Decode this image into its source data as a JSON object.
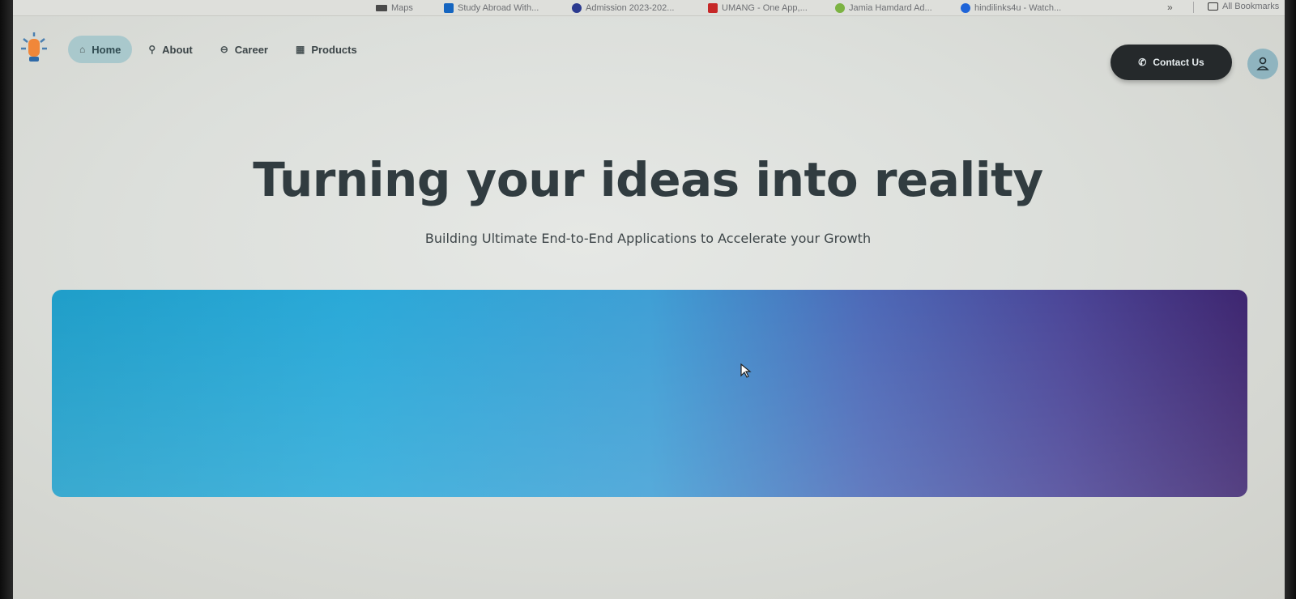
{
  "bookmarks": [
    {
      "label": "Study Abroad With...",
      "color": "#1565c0"
    },
    {
      "label": "Admission 2023-202...",
      "color": "#2b3a8f"
    },
    {
      "label": "UMANG - One App,...",
      "color": "#c62828"
    },
    {
      "label": "Jamia Hamdard Ad...",
      "color": "#7cb342"
    },
    {
      "label": "hindilinks4u - Watch...",
      "color": "#1e64d8"
    }
  ],
  "bookmarks_extra": {
    "maps_label": "Maps",
    "chevron": "»",
    "all_bookmarks": "All Bookmarks"
  },
  "nav": {
    "items": [
      {
        "label": "Home",
        "icon": "home-icon",
        "active": true
      },
      {
        "label": "About",
        "icon": "pin-icon",
        "active": false
      },
      {
        "label": "Career",
        "icon": "briefcase-icon",
        "active": false
      },
      {
        "label": "Products",
        "icon": "grid-icon",
        "active": false
      }
    ],
    "contact_label": "Contact Us"
  },
  "hero": {
    "title": "Turning your ideas into reality",
    "subtitle": "Building Ultimate End-to-End Applications to Accelerate your Growth"
  },
  "colors": {
    "primary_dark": "#25292b",
    "active_pill": "#a9c8cc",
    "banner_start": "#1f9ec9",
    "banner_end": "#3e2670"
  }
}
